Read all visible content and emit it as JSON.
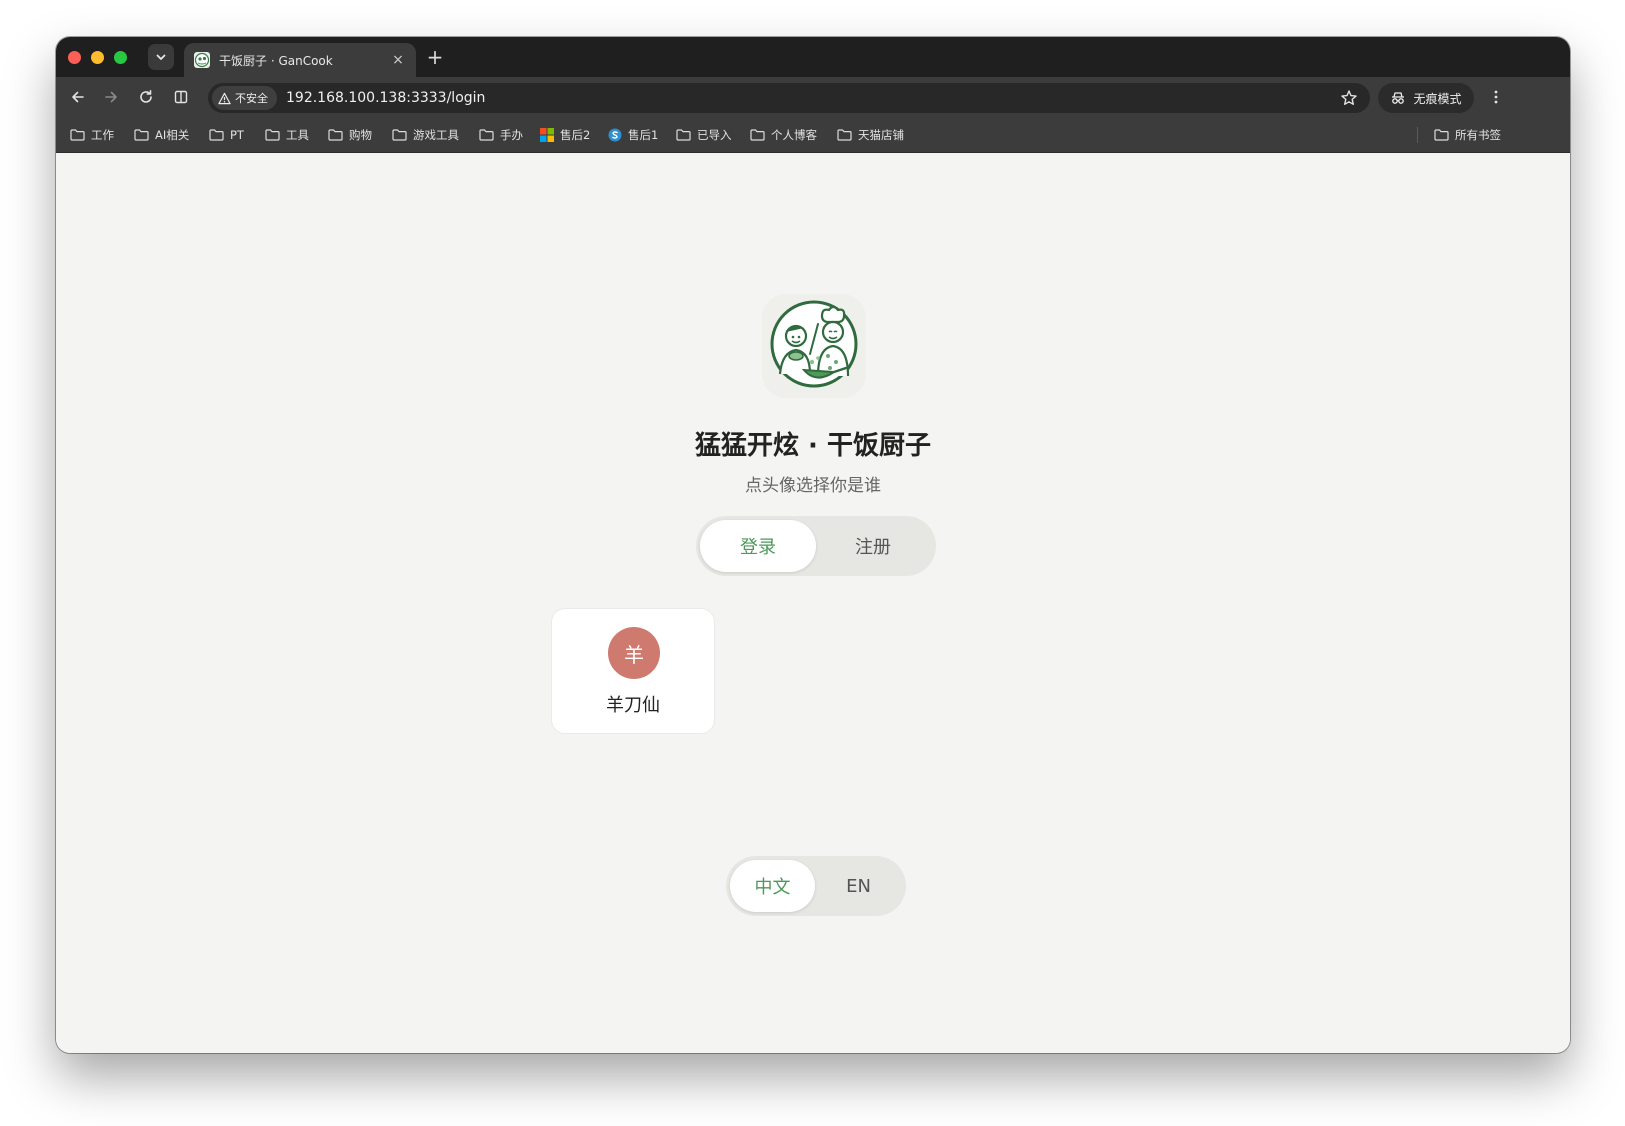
{
  "browser": {
    "tab": {
      "title": "干饭厨子 · GanCook",
      "close_glyph": "×"
    },
    "new_tab_glyph": "+",
    "address_bar": {
      "security_label": "不安全",
      "url": "192.168.100.138:3333/login"
    },
    "incognito_label": "无痕模式",
    "bookmarks": [
      {
        "label": "工作",
        "icon": "folder-icon"
      },
      {
        "label": "AI相关",
        "icon": "folder-icon"
      },
      {
        "label": "PT",
        "icon": "folder-icon"
      },
      {
        "label": "工具",
        "icon": "folder-icon"
      },
      {
        "label": "购物",
        "icon": "folder-icon"
      },
      {
        "label": "游戏工具",
        "icon": "folder-icon"
      },
      {
        "label": "手办",
        "icon": "folder-icon"
      },
      {
        "label": "售后2",
        "icon": "windows-logo-icon"
      },
      {
        "label": "售后1",
        "icon": "site-s-icon"
      },
      {
        "label": "已导入",
        "icon": "folder-icon"
      },
      {
        "label": "个人博客",
        "icon": "folder-icon"
      },
      {
        "label": "天猫店铺",
        "icon": "folder-icon"
      }
    ],
    "all_bookmarks_label": "所有书签"
  },
  "page": {
    "title": "猛猛开炫 · 干饭厨子",
    "subtitle": "点头像选择你是谁",
    "auth_tabs": [
      {
        "label": "登录",
        "active": true
      },
      {
        "label": "注册",
        "active": false
      }
    ],
    "users": [
      {
        "avatar_text": "羊",
        "name": "羊刀仙",
        "avatar_color": "#cf7a6e"
      }
    ],
    "language_tabs": [
      {
        "label": "中文",
        "active": true
      },
      {
        "label": "EN",
        "active": false
      }
    ]
  },
  "colors": {
    "accent": "#4a9a5a",
    "page_background": "#f4f4f2"
  }
}
